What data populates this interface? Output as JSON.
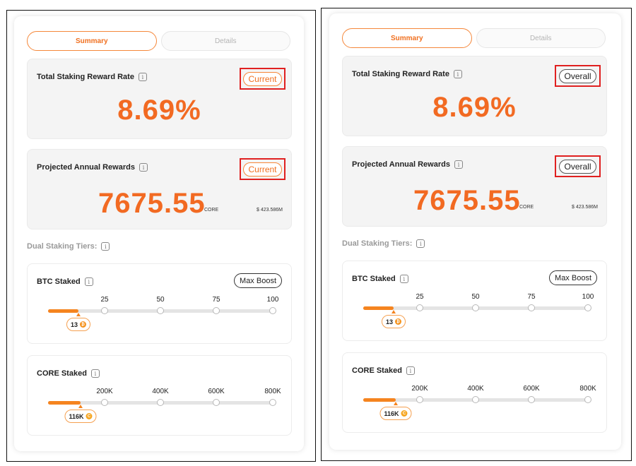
{
  "colors": {
    "accent": "#f26a22",
    "highlight_box": "#e02020"
  },
  "panels": [
    {
      "id": "left",
      "tabs": [
        {
          "label": "Summary",
          "active": true
        },
        {
          "label": "Details",
          "active": false
        }
      ],
      "rate": {
        "title": "Total Staking Reward Rate",
        "pill": "Current",
        "value": "8.69%"
      },
      "annual": {
        "title": "Projected Annual Rewards",
        "pill": "Current",
        "value": "7675.55",
        "unit": "CORE",
        "usd": "$ 423.586M"
      },
      "tiers_label": "Dual Staking Tiers:",
      "btc": {
        "title": "BTC Staked",
        "button": "Max Boost",
        "ticks": [
          "25",
          "50",
          "75",
          "100"
        ],
        "value": "13",
        "coin_icon": "bitcoin-icon",
        "progress": 13
      },
      "core": {
        "title": "CORE Staked",
        "ticks": [
          "200K",
          "400K",
          "600K",
          "800K"
        ],
        "value": "116K",
        "coin_icon": "core-icon",
        "progress": 116
      }
    },
    {
      "id": "right",
      "tabs": [
        {
          "label": "Summary",
          "active": true
        },
        {
          "label": "Details",
          "active": false
        }
      ],
      "rate": {
        "title": "Total Staking Reward Rate",
        "pill": "Overall",
        "value": "8.69%"
      },
      "annual": {
        "title": "Projected Annual Rewards",
        "pill": "Overall",
        "value": "7675.55",
        "unit": "CORE",
        "usd": "$ 423.586M"
      },
      "tiers_label": "Dual Staking Tiers:",
      "btc": {
        "title": "BTC Staked",
        "button": "Max Boost",
        "ticks": [
          "25",
          "50",
          "75",
          "100"
        ],
        "value": "13",
        "coin_icon": "bitcoin-icon",
        "progress": 13
      },
      "core": {
        "title": "CORE Staked",
        "ticks": [
          "200K",
          "400K",
          "600K",
          "800K"
        ],
        "value": "116K",
        "coin_icon": "core-icon",
        "progress": 116
      }
    }
  ]
}
